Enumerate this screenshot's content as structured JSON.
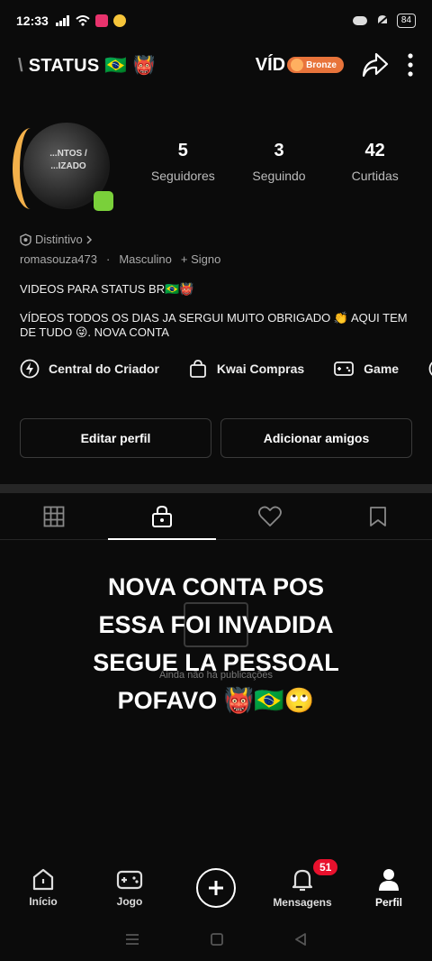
{
  "status_bar": {
    "time": "12:33",
    "battery": "84"
  },
  "header": {
    "title_fragment": "STATUS",
    "title_cut_prefix": "\\",
    "title_emoji": "🇧🇷 👹",
    "video_label_partial": "VÍD",
    "level_badge": "Bronze"
  },
  "profile": {
    "avatar_text": "...NTOS / ...IZADO",
    "stats": [
      {
        "value": "5",
        "label": "Seguidores"
      },
      {
        "value": "3",
        "label": "Seguindo"
      },
      {
        "value": "42",
        "label": "Curtidas"
      }
    ],
    "badge_label": "Distintivo",
    "username": "romasouza473",
    "gender": "Masculino",
    "sign_label": "+ Signo",
    "bio_title": "VIDEOS PARA STATUS BR🇧🇷👹",
    "bio_text": "VÍDEOS TODOS OS DIAS JA SERGUI MUITO OBRIGADO 👏 AQUI TEM DE TUDO 😜. NOVA CONTA"
  },
  "quick_links": [
    {
      "label": "Central do Criador",
      "icon": "lightning-icon"
    },
    {
      "label": "Kwai Compras",
      "icon": "shopping-bag-icon"
    },
    {
      "label": "Game",
      "icon": "gamepad-icon"
    }
  ],
  "buttons": {
    "edit_profile": "Editar perfil",
    "add_friends": "Adicionar amigos"
  },
  "content": {
    "empty_text": "Ainda não há publicações",
    "overlay_lines": [
      "NOVA CONTA POS",
      "ESSA FOI INVADIDA",
      "SEGUE LA PESSOAL",
      "POFAVO 👹🇧🇷🙄"
    ]
  },
  "bottom_nav": {
    "items": [
      {
        "label": "Início",
        "icon": "home-icon"
      },
      {
        "label": "Jogo",
        "icon": "gamepad-icon"
      },
      {
        "label": "",
        "icon": "plus-icon"
      },
      {
        "label": "Mensagens",
        "icon": "bell-icon"
      },
      {
        "label": "Perfil",
        "icon": "person-icon"
      }
    ],
    "messages_badge": "51"
  }
}
